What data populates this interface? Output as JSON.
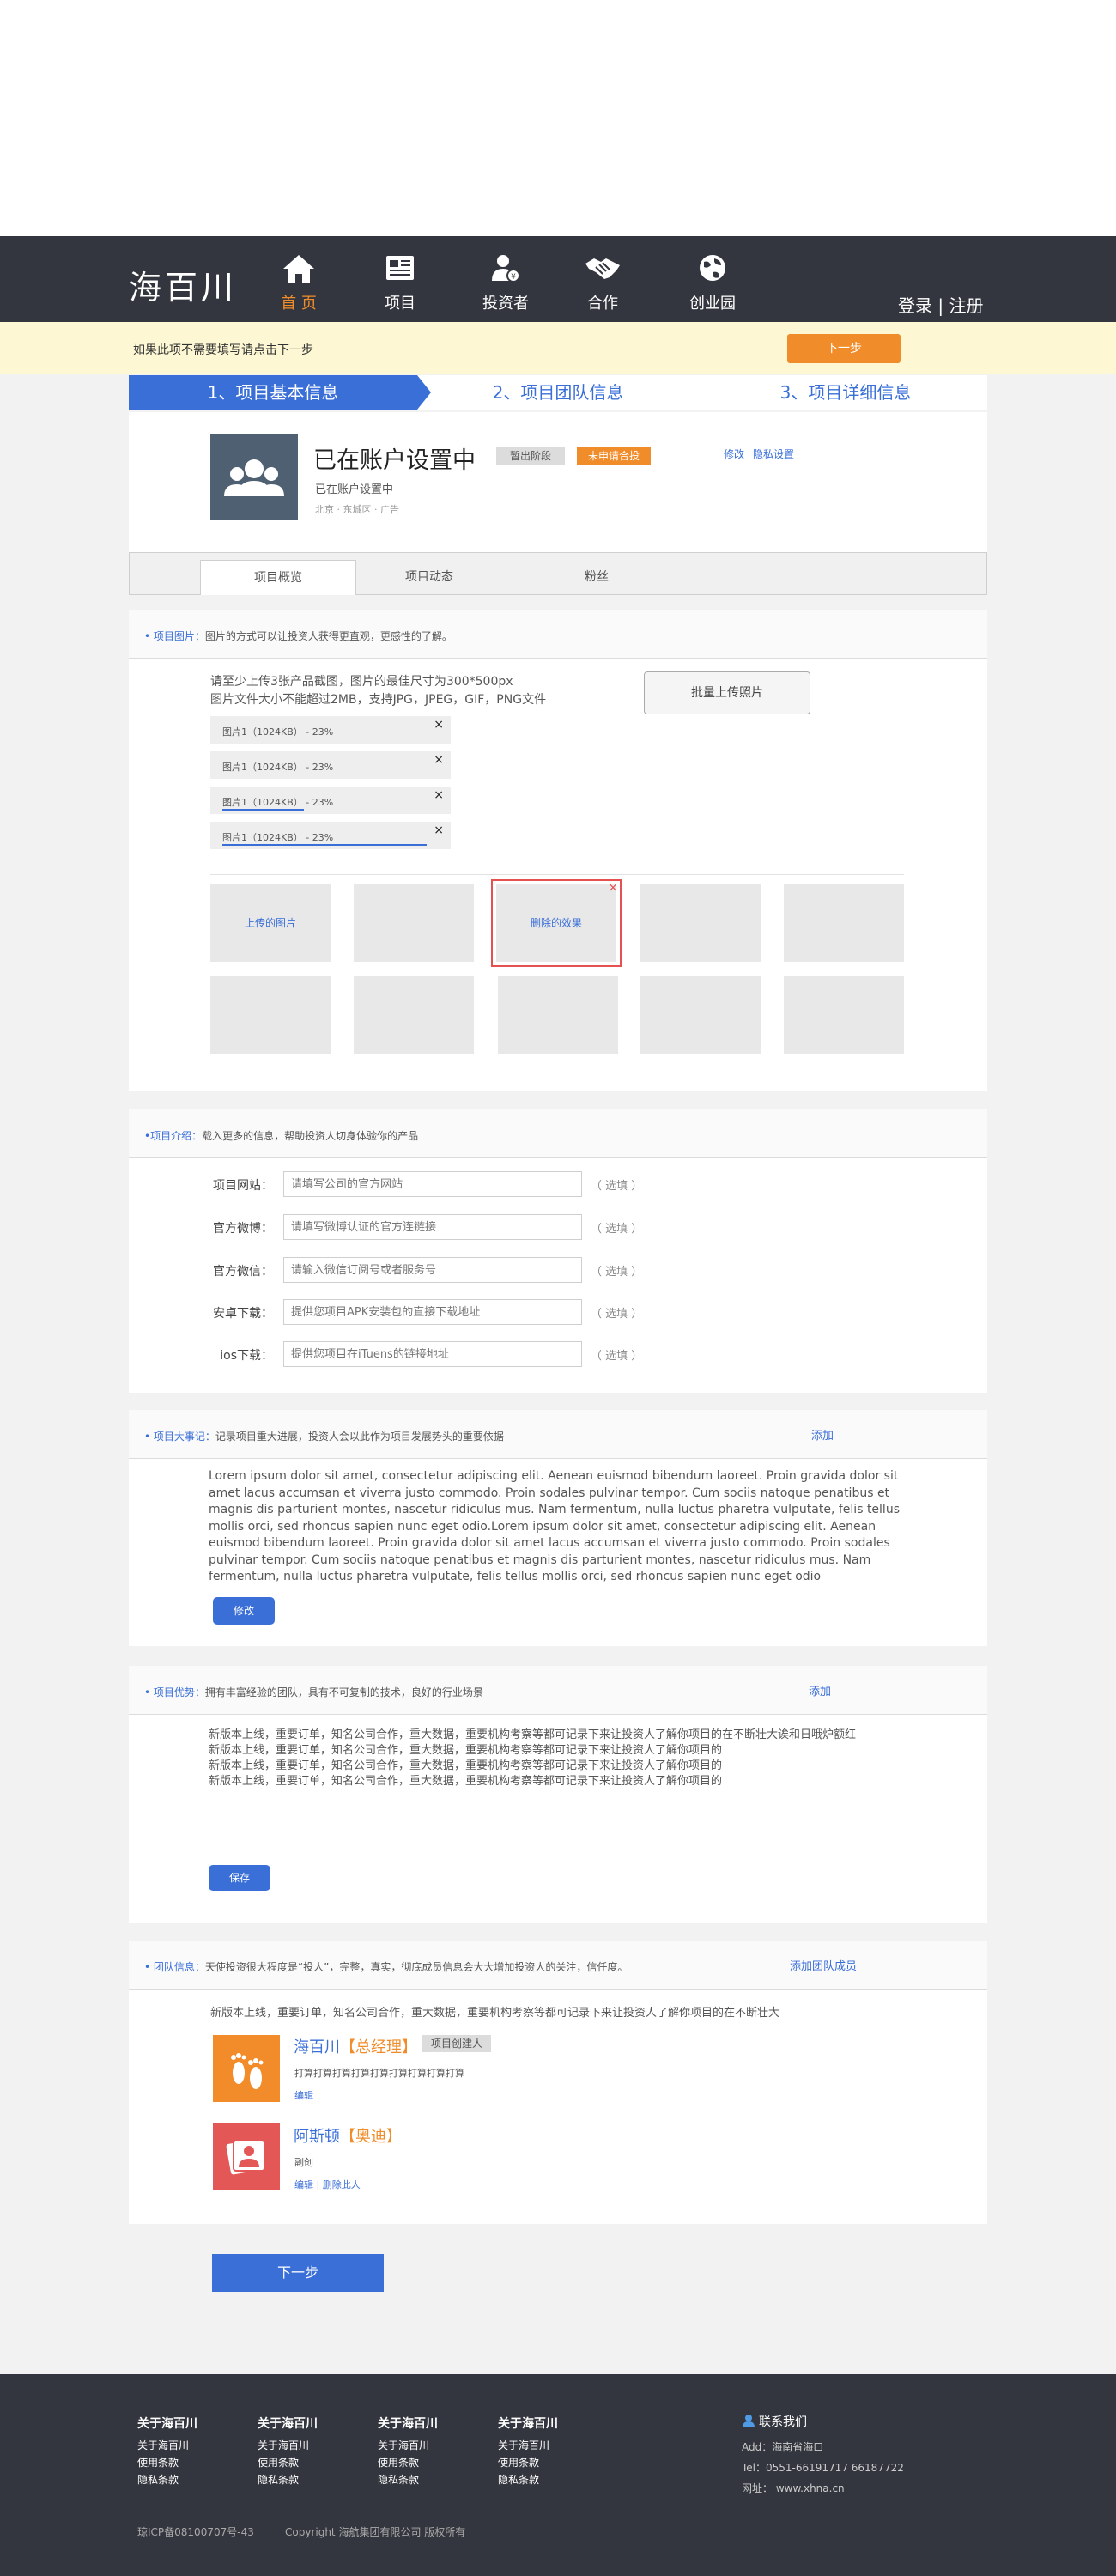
{
  "header": {
    "logo": "海百川",
    "nav": [
      {
        "label": "首 页",
        "icon": "home-icon",
        "active": true
      },
      {
        "label": "项目",
        "icon": "document-icon",
        "active": false
      },
      {
        "label": "投资者",
        "icon": "investor-icon",
        "active": false
      },
      {
        "label": "合作",
        "icon": "handshake-icon",
        "active": false
      },
      {
        "label": "创业园",
        "icon": "globe-icon",
        "active": false
      }
    ],
    "login": "登录",
    "separator": "|",
    "register": "注册"
  },
  "notice": {
    "text": "如果此项不需要填写请点击下一步",
    "next": "下一步"
  },
  "steps": [
    "1、项目基本信息",
    "2、项目团队信息",
    "3、项目详细信息"
  ],
  "profile": {
    "title": "已在账户设置中",
    "badge_stage": "暂出阶段",
    "badge_status": "未申请合投",
    "subtitle": "已在账户设置中",
    "location": "北京 · 东城区 · 广告",
    "edit": "修改",
    "privacy": "隐私设置"
  },
  "tabs": [
    "项目概览",
    "项目动态",
    "粉丝"
  ],
  "images_section": {
    "title": "• 项目图片：",
    "desc": "图片的方式可以让投资人获得更直观，更感性的了解。",
    "instr1": "请至少上传3张产品截图，图片的最佳尺寸为300*500px",
    "instr2": "图片文件大小不能超过2MB，支持JPG，JPEG，GIF，PNG文件",
    "batch_button": "批量上传照片",
    "uploads": [
      {
        "label": "图片1（1024KB） -  23%",
        "progress": 0
      },
      {
        "label": "图片1（1024KB） -  23%",
        "progress": 0
      },
      {
        "label": "图片1（1024KB） -  23%",
        "progress": 0.4
      },
      {
        "label": "图片1（1024KB） -  23%",
        "progress": 1
      }
    ],
    "thumb_uploaded": "上传的图片",
    "thumb_delete": "删除的效果",
    "close": "×"
  },
  "intro_section": {
    "title": "•项目介绍：",
    "desc": "载入更多的信息，帮助投资人切身体验你的产品",
    "optional": "（ 选填 ）",
    "fields": [
      {
        "label": "项目网站：",
        "placeholder": "请填写公司的官方网站"
      },
      {
        "label": "官方微博：",
        "placeholder": "请填写微博认证的官方连链接"
      },
      {
        "label": "官方微信：",
        "placeholder": "请输入微信订阅号或者服务号"
      },
      {
        "label": "安卓下载：",
        "placeholder": "提供您项目APK安装包的直接下载地址"
      },
      {
        "label": "ios下载：",
        "placeholder": "提供您项目在iTuens的链接地址"
      }
    ]
  },
  "events_section": {
    "title": "• 项目大事记：",
    "desc": "记录项目重大进展，投资人会以此作为项目发展势头的重要依据",
    "add": "添加",
    "text": "Lorem ipsum dolor sit amet, consectetur adipiscing elit. Aenean euismod bibendum laoreet. Proin gravida dolor sit amet lacus accumsan et viverra justo commodo. Proin sodales pulvinar tempor. Cum sociis natoque penatibus et magnis dis parturient montes, nascetur ridiculus mus. Nam fermentum, nulla luctus pharetra vulputate, felis tellus mollis orci, sed rhoncus sapien nunc eget odio.Lorem ipsum dolor sit amet, consectetur adipiscing elit. Aenean euismod bibendum laoreet. Proin gravida dolor sit amet lacus accumsan et viverra justo commodo. Proin sodales pulvinar tempor. Cum sociis natoque penatibus et magnis dis parturient montes, nascetur ridiculus mus. Nam fermentum, nulla luctus pharetra vulputate, felis tellus mollis orci, sed rhoncus sapien nunc eget odio",
    "button": "修改"
  },
  "advantage_section": {
    "title": "• 项目优势：",
    "desc": "拥有丰富经验的团队，具有不可复制的技术，良好的行业场景",
    "add": "添加",
    "lines": [
      "新版本上线，重要订单，知名公司合作，重大数据，重要机构考察等都可记录下来让投资人了解你项目的在不断壮大诶和日哦炉额红",
      "新版本上线，重要订单，知名公司合作，重大数据，重要机构考察等都可记录下来让投资人了解你项目的",
      "新版本上线，重要订单，知名公司合作，重大数据，重要机构考察等都可记录下来让投资人了解你项目的",
      "新版本上线，重要订单，知名公司合作，重大数据，重要机构考察等都可记录下来让投资人了解你项目的"
    ],
    "button": "保存"
  },
  "team_section": {
    "title": "• 团队信息：",
    "desc": "天使投资很大程度是“投人”，完整，真实，彻底成员信息会大大增加投资人的关注，信任度。",
    "add": "添加团队成员",
    "intro": "新版本上线，重要订单，知名公司合作，重大数据，重要机构考察等都可记录下来让投资人了解你项目的在不断壮大",
    "members": [
      {
        "name": "海百川",
        "role": "【总经理】",
        "tag": "项目创建人",
        "desc": "打算打算打算打算打算打算打算打算打算",
        "actions": "编辑",
        "extra": ""
      },
      {
        "name": "阿斯顿",
        "role": "【奥迪】",
        "tag": "",
        "desc": "副创",
        "actions": "编辑",
        "extra": "删除此人"
      }
    ],
    "action_sep": "|"
  },
  "next_button": "下一步",
  "footer": {
    "columns": [
      {
        "head": "关于海百川",
        "links": [
          "关于海百川",
          "使用条款",
          "隐私条款"
        ]
      },
      {
        "head": "关于海百川",
        "links": [
          "关于海百川",
          "使用条款",
          "隐私条款"
        ]
      },
      {
        "head": "关于海百川",
        "links": [
          "关于海百川",
          "使用条款",
          "隐私条款"
        ]
      },
      {
        "head": "关于海百川",
        "links": [
          "关于海百川",
          "使用条款",
          "隐私条款"
        ]
      }
    ],
    "contact_head": "联系我们",
    "address": "Add：海南省海口",
    "tel": "Tel：0551-66191717      66187722",
    "web": "网址： www.xhna.cn",
    "icp": "琼ICP备08100707号-43",
    "copyright": "Copyright      海航集团有限公司      版权所有"
  },
  "colors": {
    "nav_bg": "#33363e",
    "accent_blue": "#3a6fd8",
    "accent_orange": "#f08c2a",
    "notice_bg": "#fdf8d3"
  }
}
